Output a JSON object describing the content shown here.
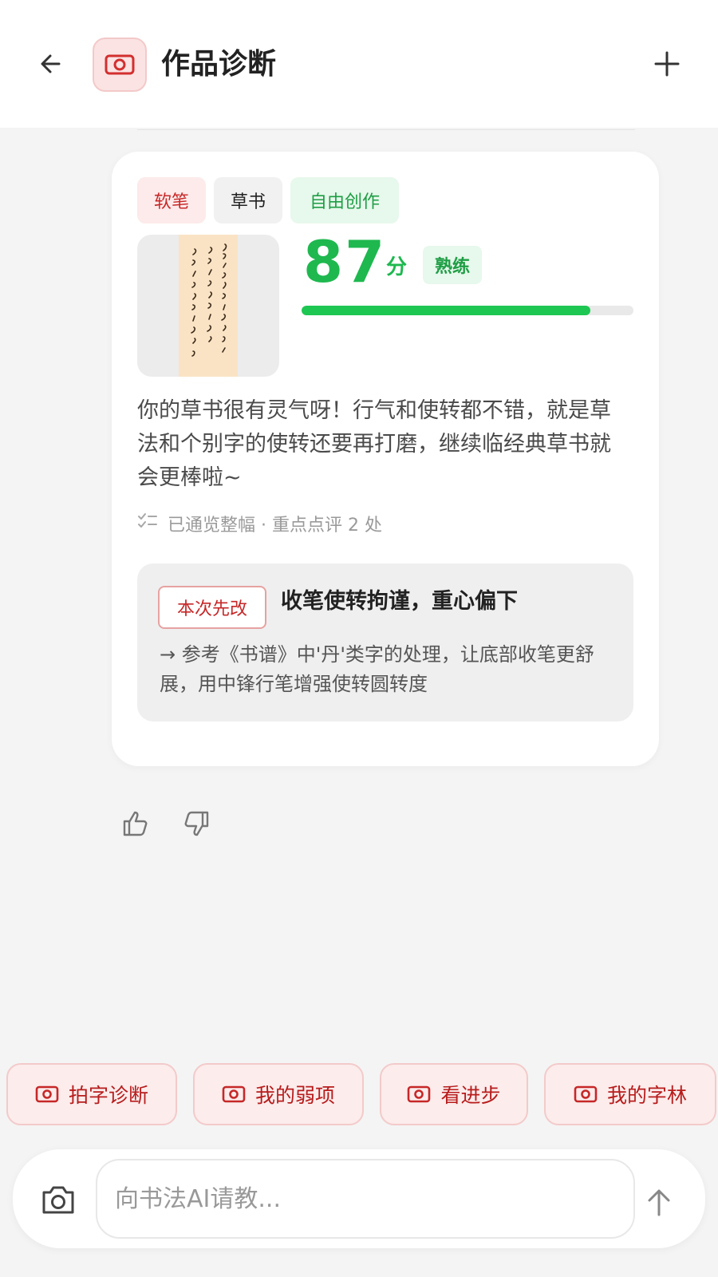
{
  "header": {
    "title": "作品诊断"
  },
  "card": {
    "tags": [
      "软笔",
      "草书",
      "自由创作"
    ],
    "score": "87",
    "score_unit": "分",
    "score_fraction": 0.87,
    "level": "熟练",
    "summary": "你的草书很有灵气呀！行气和使转都不错，就是草法和个别字的使转还要再打磨，继续临经典草书就会更棒啦~",
    "overview": "已通览整幅 · 重点点评 2 处",
    "tip": {
      "badge": "本次先改",
      "title": "收笔使转拘谨，重心偏下",
      "body": "→ 参考《书谱》中'丹'类字的处理，让底部收笔更舒展，用中锋行笔增强使转圆转度"
    }
  },
  "quick_actions": [
    "拍字诊断",
    "我的弱项",
    "看进步",
    "我的字林"
  ],
  "input": {
    "placeholder": "向书法AI请教..."
  },
  "colors": {
    "accent_red": "#c62828",
    "accent_green": "#1eb84f",
    "background": "#f4f4f4"
  }
}
